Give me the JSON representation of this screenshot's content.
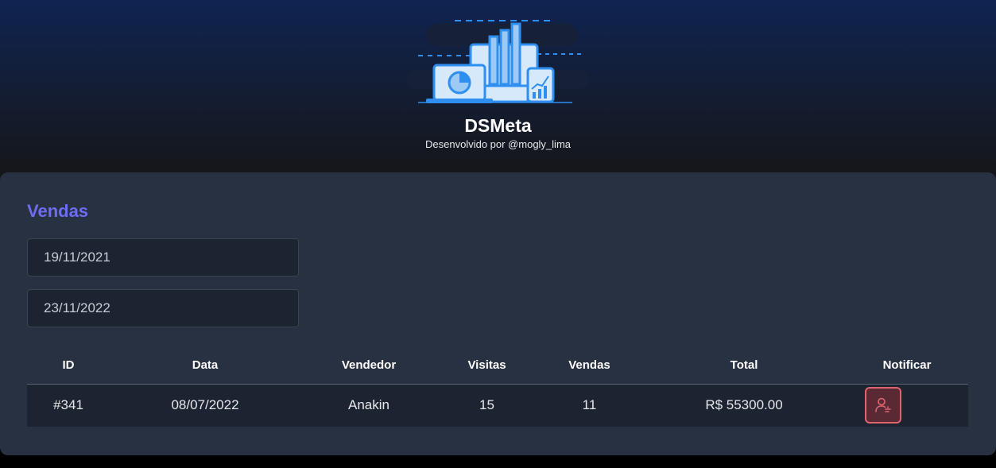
{
  "header": {
    "brand": "DSMeta",
    "developer": "Desenvolvido por @mogly_lima"
  },
  "sales": {
    "title": "Vendas",
    "min_date": "19/11/2021",
    "max_date": "23/11/2022",
    "columns": [
      "ID",
      "Data",
      "Vendedor",
      "Visitas",
      "Vendas",
      "Total",
      "Notificar"
    ],
    "rows": [
      {
        "id": "#341",
        "date": "08/07/2022",
        "seller": "Anakin",
        "visits": "15",
        "deals": "11",
        "total": "R$ 55300.00"
      }
    ]
  },
  "colors": {
    "accent": "#6e6cf0",
    "card": "#283142",
    "notify_border": "#e06470"
  },
  "icons": {
    "notify": "user-notify-icon",
    "logo": "dashboard-illustration"
  }
}
